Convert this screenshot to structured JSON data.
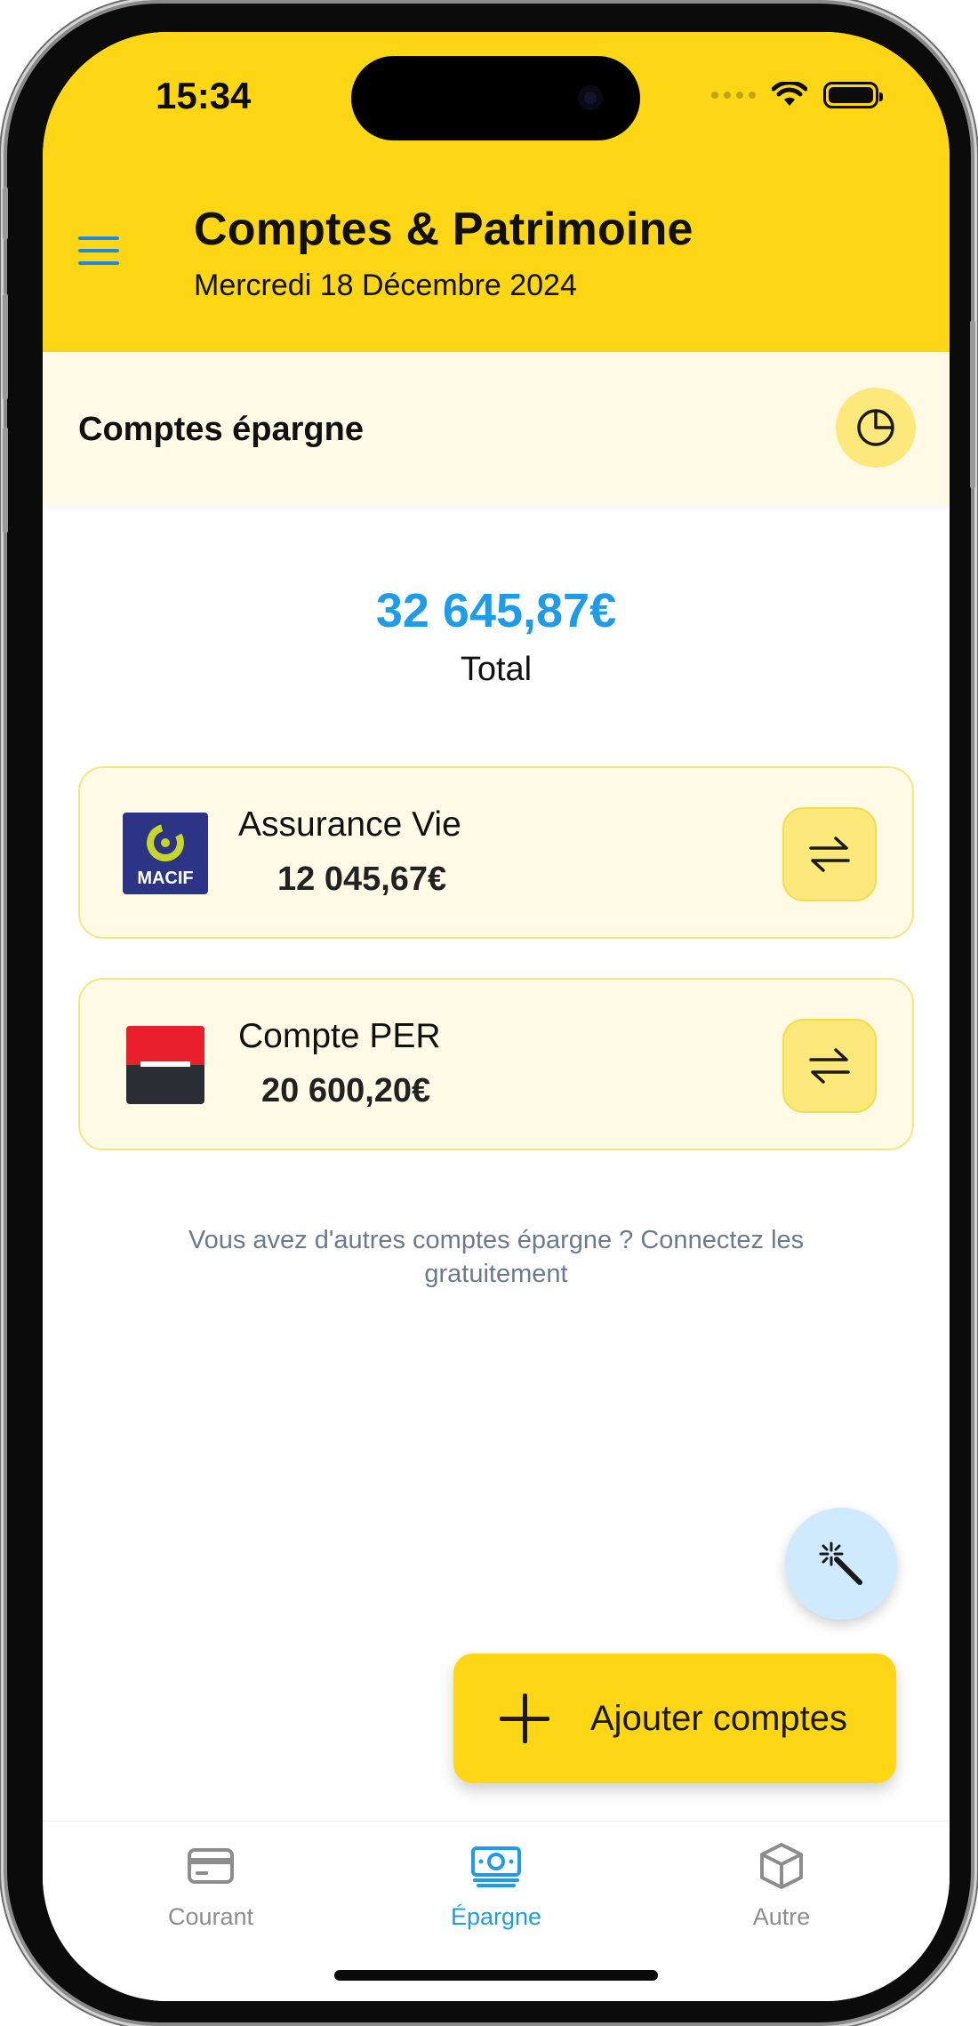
{
  "status_bar": {
    "time": "15:34"
  },
  "header": {
    "title": "Comptes & Patrimoine",
    "date": "Mercredi 18 Décembre 2024",
    "accent_color": "#fdd716",
    "menu_icon": "hamburger-menu-icon"
  },
  "section": {
    "title": "Comptes épargne",
    "chart_icon": "pie-chart-icon"
  },
  "summary": {
    "total_amount": "32 645,87€",
    "total_label": "Total",
    "amount_color": "#1e9be9"
  },
  "accounts": [
    {
      "name": "Assurance Vie",
      "amount": "12 045,67€",
      "logo_text": "MACIF",
      "logo_icon": "macif-logo",
      "action_icon": "transfer-arrows-icon"
    },
    {
      "name": "Compte PER",
      "amount": "20 600,20€",
      "logo_icon": "societe-generale-logo",
      "action_icon": "transfer-arrows-icon"
    }
  ],
  "hint": "Vous avez d'autres comptes épargne ? Connectez les gratuitement",
  "fab": {
    "icon": "magic-wand-icon"
  },
  "add_button": {
    "label": "Ajouter comptes",
    "icon": "plus-icon"
  },
  "tabs": [
    {
      "label": "Courant",
      "icon": "credit-card-icon",
      "active": false
    },
    {
      "label": "Épargne",
      "icon": "cash-icon",
      "active": true
    },
    {
      "label": "Autre",
      "icon": "cube-icon",
      "active": false
    }
  ]
}
